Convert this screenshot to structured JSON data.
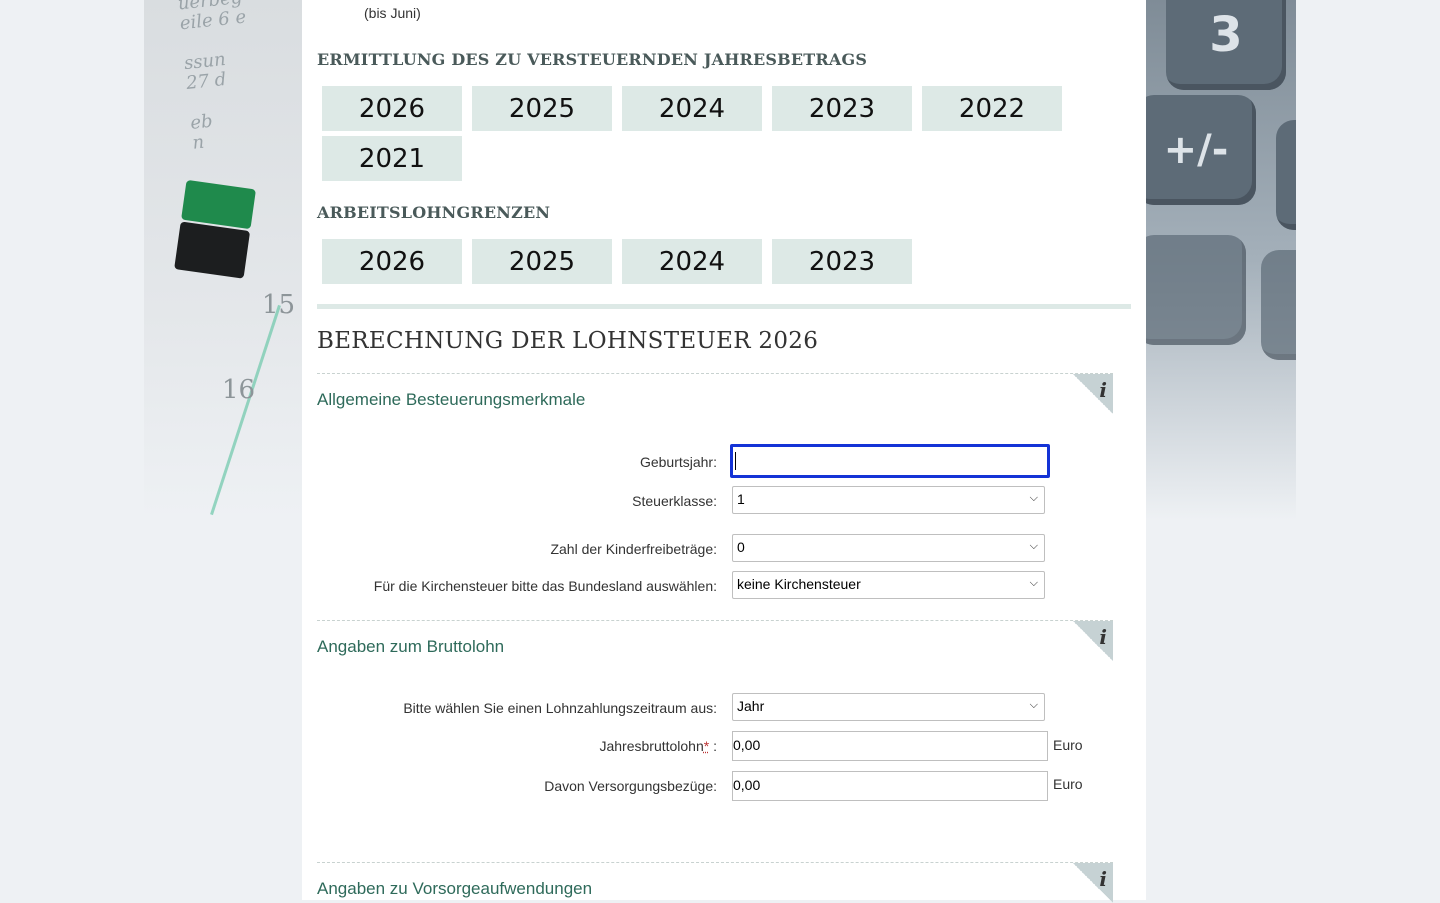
{
  "background": {
    "tape_text": [
      "uerbeg",
      "eile 6 e",
      "",
      "ssun",
      "27 d",
      "",
      "eb",
      "n"
    ],
    "numbers": [
      "15",
      "16"
    ],
    "calculator_keys": [
      "3",
      "+/-"
    ]
  },
  "note": "(bis Juni)",
  "section_annual": {
    "title": "ERMITTLUNG DES ZU VERSTEUERNDEN JAHRESBETRAGS",
    "years": [
      "2026",
      "2025",
      "2024",
      "2023",
      "2022",
      "2021"
    ]
  },
  "section_limits": {
    "title": "ARBEITSLOHNGRENZEN",
    "years": [
      "2026",
      "2025",
      "2024",
      "2023"
    ]
  },
  "main_title": "BERECHNUNG DER LOHNSTEUER 2026",
  "info_icon_glyph": "i",
  "general": {
    "title": "Allgemeine Besteuerungsmerkmale",
    "birth_year_label": "Geburtsjahr:",
    "birth_year_value": "",
    "tax_class_label": "Steuerklasse:",
    "tax_class_value": "1",
    "child_allowance_label": "Zahl der Kinderfreibeträge:",
    "child_allowance_value": "0",
    "church_label": "Für die Kirchensteuer bitte das Bundesland auswählen:",
    "church_value": "keine Kirchensteuer"
  },
  "gross": {
    "title": "Angaben zum Bruttolohn",
    "period_label": "Bitte wählen Sie einen Lohnzahlungszeitraum aus:",
    "period_value": "Jahr",
    "gross_label": "Jahresbruttolohn",
    "gross_required": "*",
    "gross_colon": ":",
    "gross_value": "0,00",
    "gross_unit": "Euro",
    "pension_label": "Davon Versorgungsbezüge:",
    "pension_value": "0,00",
    "pension_unit": "Euro"
  },
  "provision": {
    "title": "Angaben zu Vorsorgeaufwendungen"
  }
}
